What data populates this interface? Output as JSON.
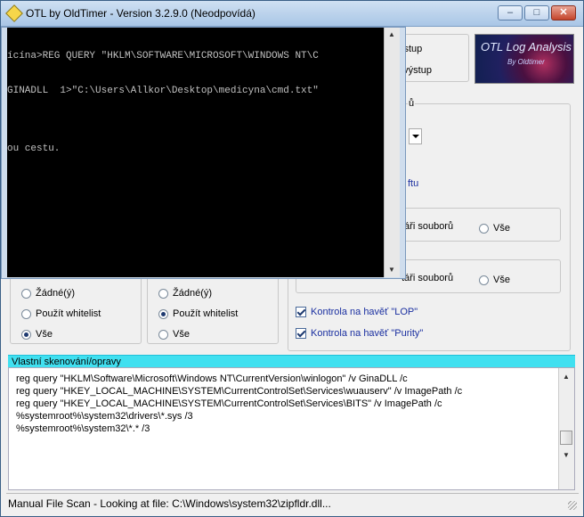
{
  "window": {
    "title": "OTL by OldTimer - Version 3.2.9.0 (Neodpovídá)",
    "minimize_glyph": "–",
    "maximize_glyph": "□",
    "close_glyph": "✕"
  },
  "logo": {
    "line1": "OTL Log Analysis",
    "line2": "By Oldtimer"
  },
  "partial": {
    "output1": "ýstup",
    "output2": "' výstup",
    "group_suffix": "ů",
    "link_fragment": "ftu",
    "row1_label": "táři souborů",
    "row1_all": "Vše",
    "row2_label": "táři souborů",
    "row2_all": "Vše"
  },
  "left_group": {
    "items": [
      "Žádné(ý)",
      "Použít whitelist",
      "Vše"
    ]
  },
  "mid_group": {
    "items": [
      "Žádné(ý)",
      "Použít whitelist",
      "Vše"
    ]
  },
  "checks": {
    "lop": "Kontrola na havěť \"LOP\"",
    "purity": "Kontrola na havěť \"Purity\""
  },
  "cmd": {
    "lines": [
      "ícína>REG QUERY \"HKLM\\SOFTWARE\\MICROSOFT\\WINDOWS NT\\C",
      "GINADLL  1>\"C:\\Users\\Allkor\\Desktop\\medicyna\\cmd.txt\"",
      "",
      "ou cestu."
    ]
  },
  "custom": {
    "header": "Vlastní skenování/opravy",
    "lines": [
      "reg query \"HKLM\\Software\\Microsoft\\Windows NT\\CurrentVersion\\winlogon\" /v GinaDLL /c",
      "reg query \"HKEY_LOCAL_MACHINE\\SYSTEM\\CurrentControlSet\\Services\\wuauserv\" /v ImagePath /c",
      "reg query \"HKEY_LOCAL_MACHINE\\SYSTEM\\CurrentControlSet\\Services\\BITS\" /v ImagePath /c",
      "%systemroot%\\system32\\drivers\\*.sys /3",
      "%systemroot%\\system32\\*.* /3"
    ]
  },
  "status": "Manual File Scan - Looking at file: C:\\Windows\\system32\\zipfldr.dll..."
}
